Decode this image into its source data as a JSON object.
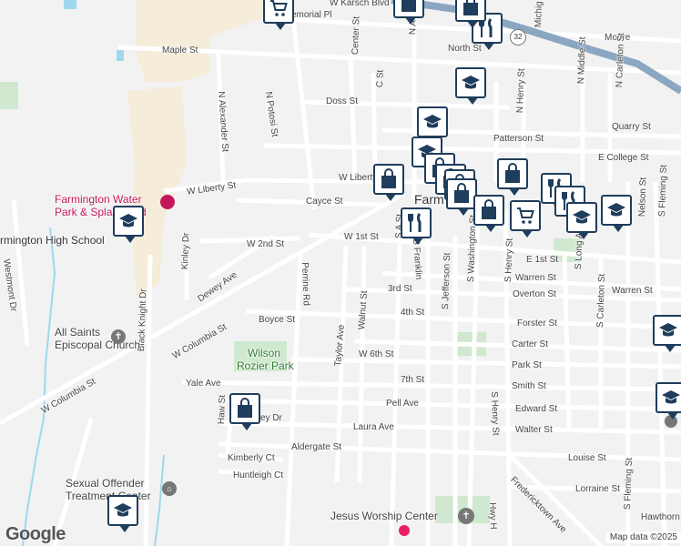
{
  "streets": [
    {
      "name": "W Karsch Blvd"
    },
    {
      "name": "Maple St"
    },
    {
      "name": "Moore"
    },
    {
      "name": "North St"
    },
    {
      "name": "N Potosi St"
    },
    {
      "name": "N Alexander St"
    },
    {
      "name": "Center St"
    },
    {
      "name": "C St"
    },
    {
      "name": "Doss St"
    },
    {
      "name": "N A St"
    },
    {
      "name": "W Liberty St"
    },
    {
      "name": "W Liberty"
    },
    {
      "name": "Cayce St"
    },
    {
      "name": "W 2nd St"
    },
    {
      "name": "W 1st St"
    },
    {
      "name": "Dewey Ave"
    },
    {
      "name": "Kinley Dr"
    },
    {
      "name": "Westmont Dr"
    },
    {
      "name": "Black Knight Dr"
    },
    {
      "name": "Perrine Rd"
    },
    {
      "name": "W Columbia St"
    },
    {
      "name": "W Columbia St"
    },
    {
      "name": "Boyce St"
    },
    {
      "name": "Taylor Ave"
    },
    {
      "name": "Walnut St"
    },
    {
      "name": "3rd St"
    },
    {
      "name": "4th St"
    },
    {
      "name": "W 6th St"
    },
    {
      "name": "7th St"
    },
    {
      "name": "Yale Ave"
    },
    {
      "name": "Haw St"
    },
    {
      "name": "ey Dr"
    },
    {
      "name": "Pell Ave"
    },
    {
      "name": "Laura Ave"
    },
    {
      "name": "Aldergate St"
    },
    {
      "name": "Kimberly Ct"
    },
    {
      "name": "Huntleigh Ct"
    },
    {
      "name": "S Franklin"
    },
    {
      "name": "S Jefferson St"
    },
    {
      "name": "S Washington St"
    },
    {
      "name": "S Henry St"
    },
    {
      "name": "S Henry St"
    },
    {
      "name": "Hwy H"
    },
    {
      "name": "Fredericktown Ave"
    },
    {
      "name": "E 1st St"
    },
    {
      "name": "Warren St"
    },
    {
      "name": "Warren St"
    },
    {
      "name": "Overton St"
    },
    {
      "name": "Forster St"
    },
    {
      "name": "Carter St"
    },
    {
      "name": "Park St"
    },
    {
      "name": "Smith St"
    },
    {
      "name": "Edward St"
    },
    {
      "name": "Walter St"
    },
    {
      "name": "Louise St"
    },
    {
      "name": "Lorraine St"
    },
    {
      "name": "Hawthorn"
    },
    {
      "name": "Patterson St"
    },
    {
      "name": "E College St"
    },
    {
      "name": "N Carleton St"
    },
    {
      "name": "N Middle St"
    },
    {
      "name": "N Henry St"
    },
    {
      "name": "Quarry St"
    },
    {
      "name": "S Long Ave"
    },
    {
      "name": "S Carleton St"
    },
    {
      "name": "S Fleming St"
    },
    {
      "name": "S Fleming St"
    },
    {
      "name": "Nelson St"
    },
    {
      "name": "S A St"
    },
    {
      "name": "emorial Pl"
    },
    {
      "name": "Michig"
    }
  ],
  "places": [
    {
      "name": "Farmington Water Park & Splash Pad",
      "lines": [
        "Farmington Water",
        "Park & Splash Pad"
      ],
      "color": "#c2185b"
    },
    {
      "name": "Farmington High School",
      "lines": [
        "rmington High School"
      ],
      "color": "#333333"
    },
    {
      "name": "All Saints Episcopal Church",
      "lines": [
        "All Saints",
        "Episcopal Church"
      ],
      "color": "#444444"
    },
    {
      "name": "Wilson Rozier Park",
      "lines": [
        "Wilson",
        "Rozier Park"
      ],
      "color": "#2e7d32"
    },
    {
      "name": "Sexual Offender Treatment Center",
      "lines": [
        "Sexual Offender",
        "Treatment Center"
      ],
      "color": "#444444"
    },
    {
      "name": "Jesus Worship Center",
      "lines": [
        "Jesus Worship Center"
      ],
      "color": "#444444"
    }
  ],
  "town_label": "Farm",
  "route_shield": "32",
  "markers": [
    {
      "type": "shopping-cart"
    },
    {
      "type": "shopping-bag"
    },
    {
      "type": "restaurant"
    },
    {
      "type": "shopping-bag"
    },
    {
      "type": "school"
    },
    {
      "type": "school"
    },
    {
      "type": "school"
    },
    {
      "type": "shopping-bag"
    },
    {
      "type": "shopping-bag"
    },
    {
      "type": "shopping-bag"
    },
    {
      "type": "shopping-bag"
    },
    {
      "type": "shopping-bag"
    },
    {
      "type": "restaurant"
    },
    {
      "type": "shopping-bag"
    },
    {
      "type": "restaurant"
    },
    {
      "type": "shopping-bag"
    },
    {
      "type": "shopping-cart"
    },
    {
      "type": "restaurant"
    },
    {
      "type": "school"
    },
    {
      "type": "school"
    },
    {
      "type": "school"
    },
    {
      "type": "school"
    },
    {
      "type": "shopping-bag"
    },
    {
      "type": "school"
    },
    {
      "type": "school"
    }
  ],
  "attribution": {
    "logo": "Google",
    "map_data": "Map data ©2025"
  },
  "colors": {
    "marker_border": "#1f3d5c",
    "highway": "#8aa6c1",
    "park": "#cfe8cf",
    "school_area": "#f5ecd9"
  }
}
